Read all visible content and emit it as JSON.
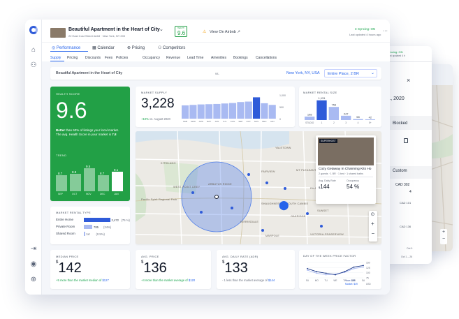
{
  "background_windows": {
    "win2": {
      "syncing": "Syncing: ON",
      "last_updated": "Last updated 4 h",
      "close": "×",
      "date": "11, 2020",
      "blocked": "Blocked",
      "custom": "Custom",
      "cad302": "CAD 302",
      "v4": "4",
      "cad101": "CAD 101",
      "cad136": "CAD 136",
      "oct9": "Oct 9",
      "oct1": "Oct 1 – 26"
    },
    "win3": {
      "syncing": "Syncing: O",
      "last_updated": "Last update"
    }
  },
  "header": {
    "title": "Beautiful Apartment in the Heart of City",
    "address": "22 East Cost Street #A18 · New York, NY 200",
    "score_label": "HEALTH",
    "score": "9.6",
    "view_airbnb": "View On Airbnb ↗",
    "syncing": "Syncing: ON",
    "last_updated": "Last updated 4 hours ago",
    "more": "···"
  },
  "tabs": [
    "Performance",
    "Calendar",
    "Pricing",
    "Competitors"
  ],
  "subtabs": [
    "Supply",
    "Pricing",
    "Discounts",
    "Fees",
    "Policies",
    "Occupancy",
    "Revenue",
    "Lead Time",
    "Amenities",
    "Bookings",
    "Cancellations"
  ],
  "compare": {
    "left": "Beautiful Apartment in the Heart of City",
    "vs": "vs.",
    "location": "New York, NY, USA",
    "filter": "Entire Place, 2 BR"
  },
  "health": {
    "label": "HEALTH SCORE",
    "score": "9.6",
    "desc_bold": "Better",
    "desc": " than 60% of listings your local market. The avg. Health Score in your market is ",
    "desc_score": "7.8",
    "trend_label": "TREND",
    "trend_values": [
      8.7,
      8.9,
      9.5,
      8.7,
      9.1
    ],
    "trend_months": [
      "SEP",
      "OCT",
      "NOV",
      "DEC",
      "JAN"
    ]
  },
  "rental_type": {
    "label": "MARKET RENTAL TYPE",
    "rows": [
      {
        "name": "Entire Home",
        "value": "2,472",
        "pct": "(75 %)",
        "frac": 0.75
      },
      {
        "name": "Private Room",
        "value": "785",
        "pct": "(24%)",
        "frac": 0.24
      },
      {
        "name": "Shared Room",
        "value": "14",
        "pct": "(0.5%)",
        "frac": 0.005
      }
    ]
  },
  "supply": {
    "label": "MARKET SUPPLY",
    "value": "3,228",
    "change": "+10%",
    "change_note": " vs. August 2020",
    "months": [
      "FEB",
      "MAR",
      "APR",
      "MAY",
      "JUN",
      "JUL",
      "AUG",
      "SEP",
      "OCT",
      "NOV",
      "DEC",
      "JAN"
    ],
    "values": [
      560,
      580,
      600,
      610,
      620,
      640,
      660,
      700,
      720,
      900,
      650,
      580
    ],
    "ticks": [
      "1,000",
      "500",
      "0"
    ],
    "highlight": 9
  },
  "size": {
    "label": "MARKET RENTAL SIZE",
    "categories": [
      "STUDIO",
      "1",
      "2",
      "3",
      "4",
      "5+"
    ],
    "values": [
      198,
      1131,
      753,
      247,
      58,
      42
    ],
    "labels": [
      "198",
      "1,131",
      "753",
      "247",
      "58",
      "42"
    ]
  },
  "map": {
    "labels": [
      "YALETOWN",
      "KITSILANO",
      "FAIRVIEW",
      "MT PLEASANT",
      "WEST POINT GREY",
      "ARBUTUS RIDGE",
      "SHAUGHNESSY",
      "SOUTH CAMBIE",
      "KERRISDALE",
      "OAKRIDGE",
      "MARPOLE",
      "SUNSET",
      "RILEY PARK",
      "VICTORIA-FRASERVIEW",
      "Pacific Spirit Regional Park"
    ],
    "popup": {
      "badge": "SUPERHOST",
      "title": "Cozy Getaway In Charming Kits Ho",
      "sub": "2 guests · 1 BR · 1 bed · 1 shared baths",
      "adr_label": "Avg. Daily Rate",
      "adr": "144",
      "occ_label": "Occupancy",
      "occ": "54 %"
    }
  },
  "metrics": [
    {
      "label": "MEDIAN PRICE",
      "value": "142",
      "note": "+5 more than the market median of ",
      "ref": "$127"
    },
    {
      "label": "AVG. PRICE",
      "value": "136",
      "note": "+4 more than the market average of ",
      "ref": "$120"
    },
    {
      "label": "AVG. DAILY RATE (ADR)",
      "value": "133",
      "note": "- 1 less than the market average of ",
      "ref": "$144"
    }
  ],
  "dow": {
    "label": "DAY OF THE WEEK PRICE FACTOR",
    "days": [
      "SU",
      "MO",
      "TU",
      "WE",
      "TH",
      "FR",
      "SA"
    ],
    "yours": [
      1.2,
      1.1,
      1.05,
      1.0,
      1.1,
      1.25,
      1.3
    ],
    "market": [
      1.15,
      1.05,
      1.0,
      1.02,
      1.08,
      1.2,
      1.25
    ],
    "ticks": [
      "150",
      "125",
      "100",
      "75"
    ],
    "unit": "USD",
    "legend_yours": "Your: $45",
    "legend_market": "Market: $49"
  },
  "colors": {
    "accent": "#2563eb",
    "green": "#22a046",
    "bar": "#a9baf2",
    "bar_highlight": "#2f5bd9"
  }
}
